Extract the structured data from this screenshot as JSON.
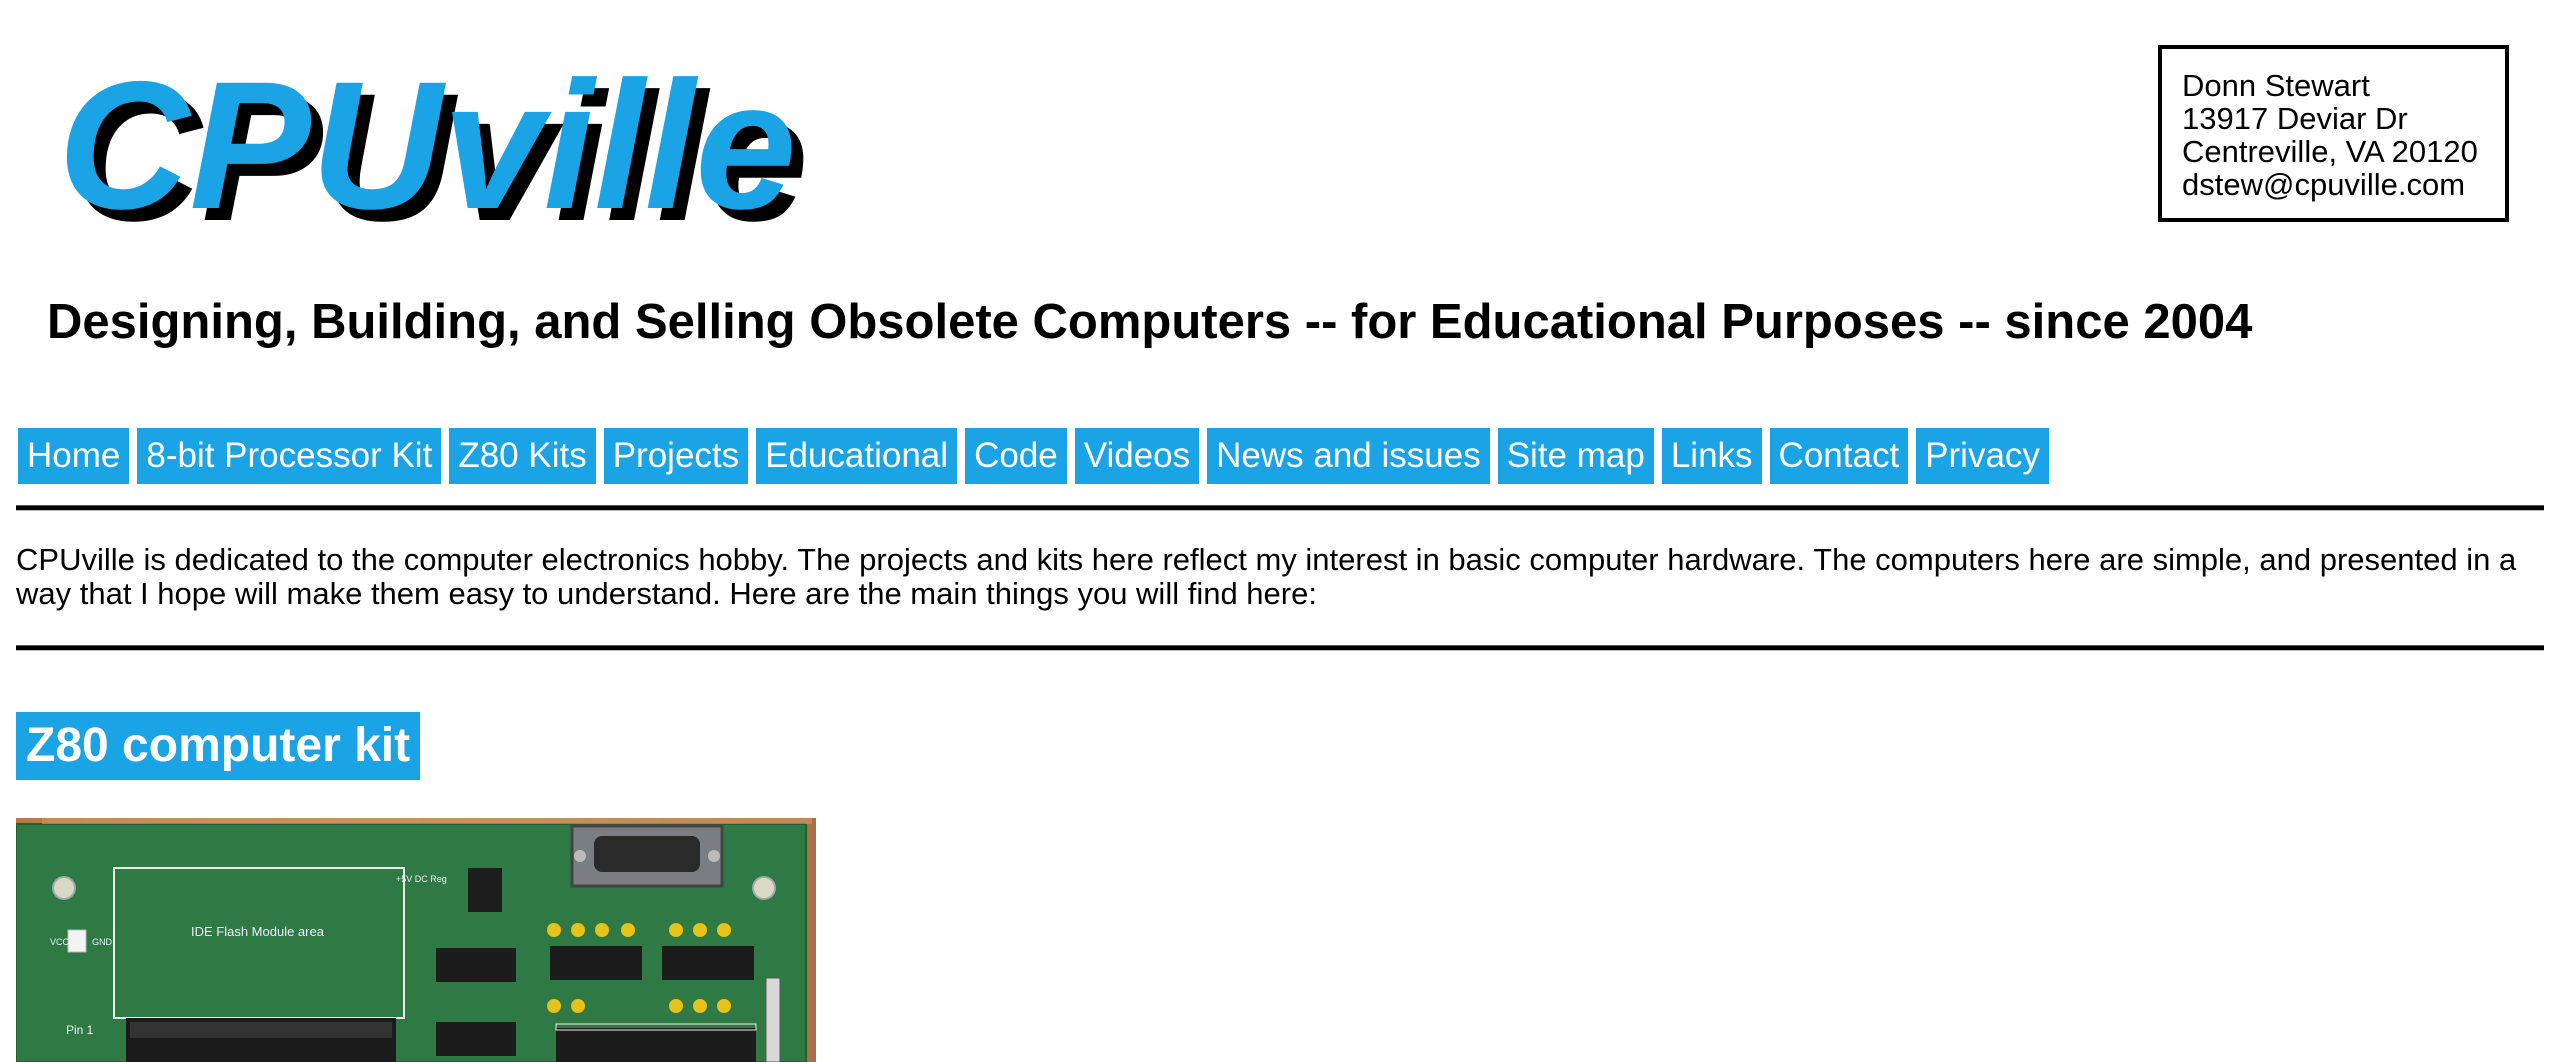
{
  "logo": {
    "text": "CPUville",
    "front_color": "#1aa4e5",
    "shadow_color": "#000000"
  },
  "address": {
    "lines": [
      "Donn Stewart",
      "13917 Deviar Dr",
      "Centreville, VA 20120",
      "dstew@cpuville.com"
    ]
  },
  "tagline": "Designing, Building, and Selling Obsolete Computers -- for Educational Purposes -- since 2004",
  "nav": {
    "items": [
      {
        "label": "Home"
      },
      {
        "label": "8-bit Processor Kit"
      },
      {
        "label": "Z80 Kits"
      },
      {
        "label": "Projects"
      },
      {
        "label": "Educational"
      },
      {
        "label": "Code"
      },
      {
        "label": "Videos"
      },
      {
        "label": "News and issues"
      },
      {
        "label": "Site map"
      },
      {
        "label": "Links"
      },
      {
        "label": "Contact"
      },
      {
        "label": "Privacy"
      }
    ]
  },
  "intro": "CPUville is dedicated to the computer electronics hobby. The projects and kits here reflect my interest in basic computer hardware. The computers here are simple, and presented in a way that I hope will make them easy to understand. Here are the main things you will find here:",
  "section": {
    "heading": "Z80 computer kit",
    "photo": {
      "silkscreen": {
        "ide_area": "IDE Flash Module area",
        "vcc": "VCC",
        "gnd": "GND",
        "pin1": "Pin 1",
        "dc_reg": "+5V DC Reg"
      }
    }
  },
  "colors": {
    "accent": "#1aa4e5",
    "text": "#000000",
    "background": "#ffffff"
  }
}
